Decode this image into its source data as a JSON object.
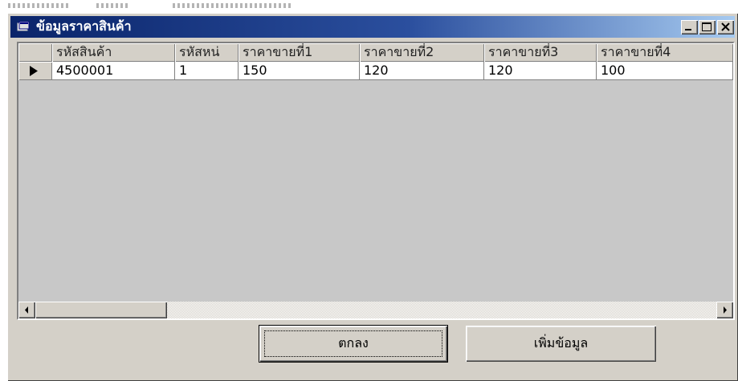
{
  "window": {
    "title": "ข้อมูลราคาสินค้า"
  },
  "grid": {
    "columns": [
      "รหัสสินค้า",
      "รหัสหน่",
      "ราคาขายที่1",
      "ราคาขายที่2",
      "ราคาขายที่3",
      "ราคาขายที่4"
    ],
    "rows": [
      [
        "4500001",
        "1",
        "150",
        "120",
        "120",
        "100"
      ]
    ]
  },
  "buttons": {
    "ok_label": "ตกลง",
    "add_label": "เพิ่มข้อมูล"
  },
  "icons": {
    "title": "window-app-icon",
    "minimize": "minimize-icon",
    "maximize": "maximize-icon",
    "close": "close-icon",
    "row_selector": "current-row-arrow-icon",
    "scroll_left": "scroll-left-arrow-icon",
    "scroll_right": "scroll-right-arrow-icon"
  },
  "colors": {
    "title_bar_start": "#0a246a",
    "title_bar_end": "#a6caf0",
    "face": "#d4d0c8"
  }
}
